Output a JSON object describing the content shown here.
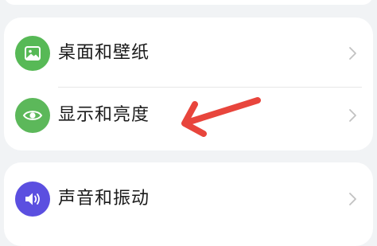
{
  "settings": {
    "items": [
      {
        "label": "桌面和壁纸",
        "icon": "wallpaper-icon",
        "icon_color": "#57b956"
      },
      {
        "label": "显示和亮度",
        "icon": "eye-icon",
        "icon_color": "#5cb85a"
      },
      {
        "label": "声音和振动",
        "icon": "speaker-icon",
        "icon_color": "#5b4fe0"
      }
    ]
  },
  "annotation": {
    "color": "#e8453c",
    "points_to": "显示和亮度"
  }
}
